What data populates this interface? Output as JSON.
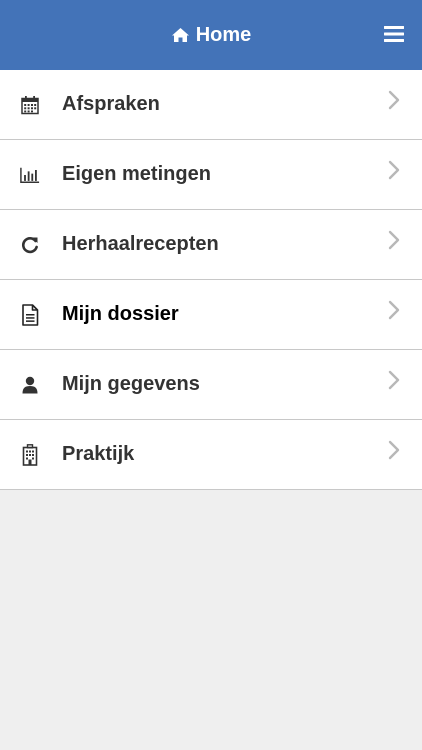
{
  "header": {
    "title": "Home",
    "home_icon": "home-icon",
    "menu_icon": "hamburger-menu-icon",
    "background_color": "#4373b8"
  },
  "menu": {
    "items": [
      {
        "label": "Afspraken",
        "icon": "calendar-icon"
      },
      {
        "label": "Eigen metingen",
        "icon": "bar-chart-icon"
      },
      {
        "label": "Herhaalrecepten",
        "icon": "refresh-icon"
      },
      {
        "label": "Mijn dossier",
        "icon": "document-icon"
      },
      {
        "label": "Mijn gegevens",
        "icon": "user-icon"
      },
      {
        "label": "Praktijk",
        "icon": "building-icon"
      }
    ],
    "chevron_icon": "chevron-right-icon"
  }
}
